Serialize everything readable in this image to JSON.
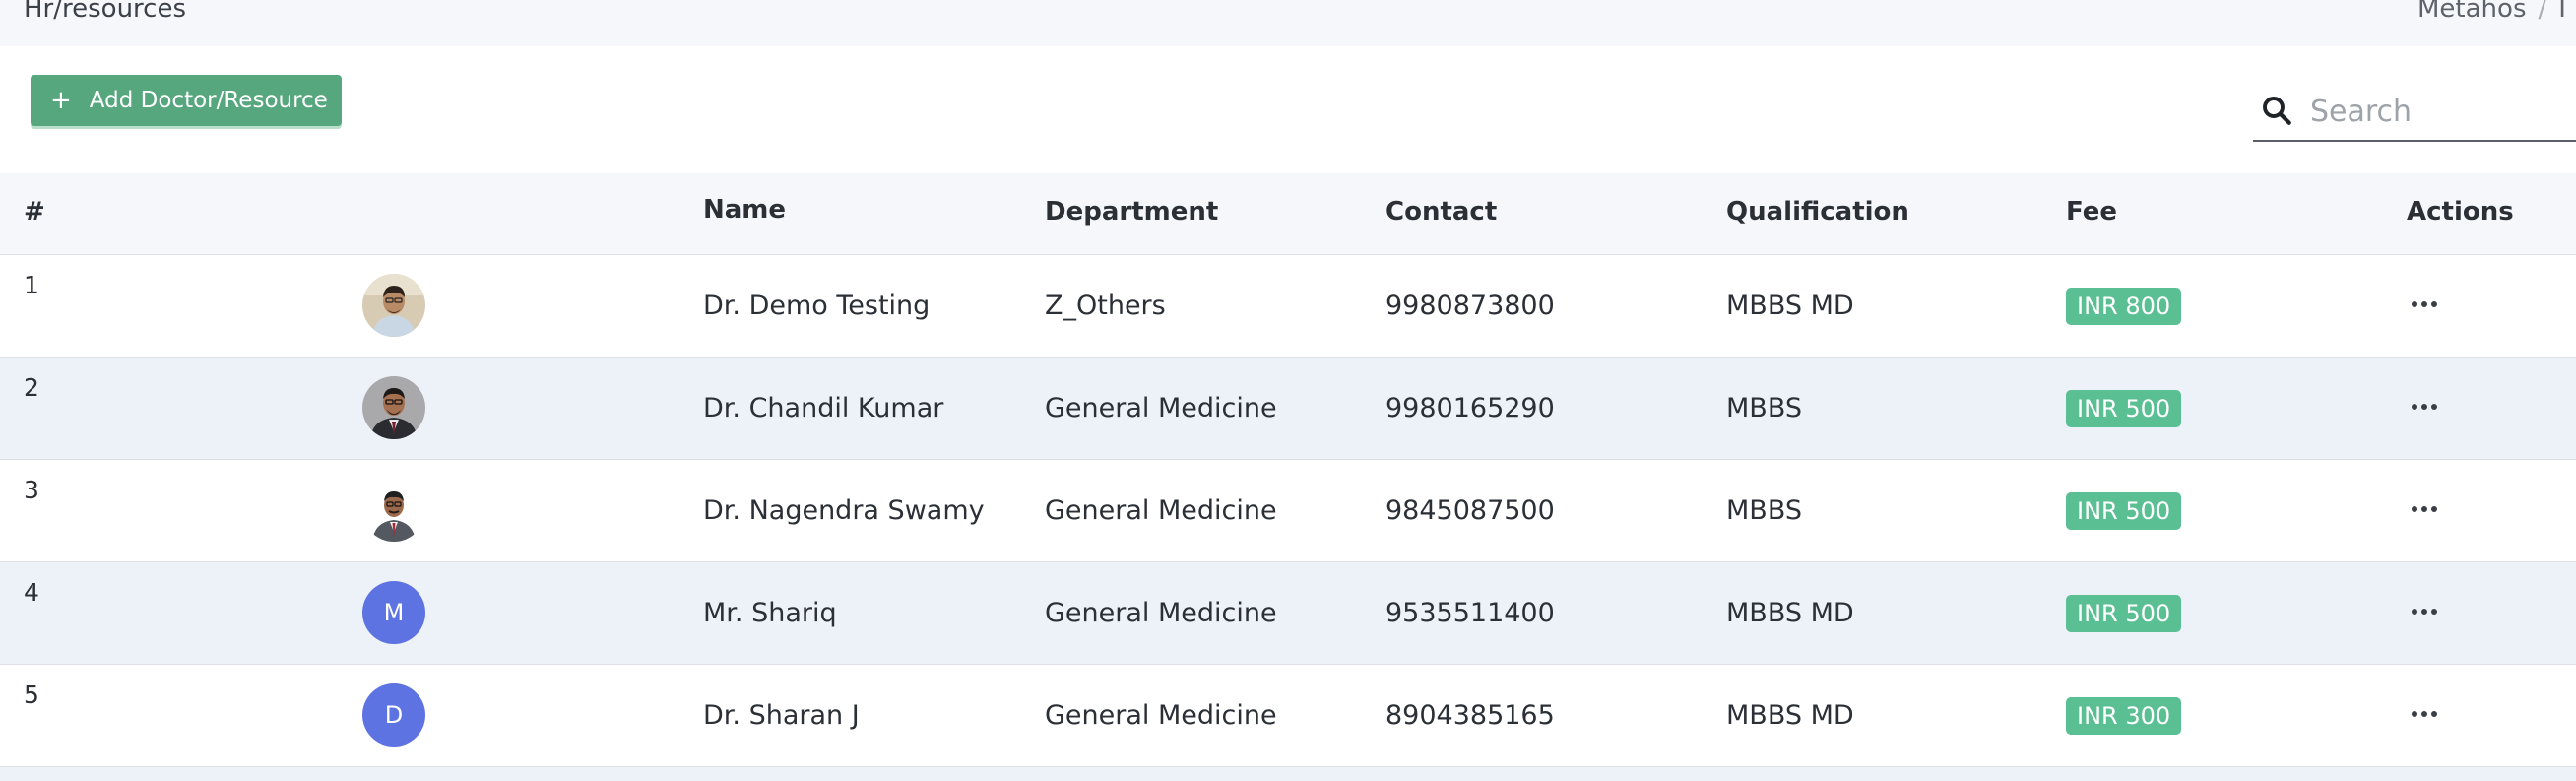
{
  "header": {
    "title": "Hr/resources",
    "breadcrumb": [
      "Metahos",
      "/",
      "I"
    ]
  },
  "toolbar": {
    "add_button_icon": "+",
    "add_button_label": "Add Doctor/Resource",
    "search_placeholder": "Search",
    "search_value": ""
  },
  "table": {
    "columns": [
      "#",
      "",
      "Name",
      "Department",
      "Contact",
      "Qualification",
      "Fee",
      "Actions"
    ],
    "rows": [
      {
        "index": "1",
        "avatar": "photo",
        "avatar_letter": "",
        "name": "Dr. Demo Testing",
        "department": "Z_Others",
        "contact": "9980873800",
        "qualification": "MBBS MD",
        "fee": "INR 800"
      },
      {
        "index": "2",
        "avatar": "photo",
        "avatar_letter": "",
        "name": "Dr. Chandil Kumar",
        "department": "General Medicine",
        "contact": "9980165290",
        "qualification": "MBBS",
        "fee": "INR 500"
      },
      {
        "index": "3",
        "avatar": "photo",
        "avatar_letter": "",
        "name": "Dr. Nagendra Swamy",
        "department": "General Medicine",
        "contact": "9845087500",
        "qualification": "MBBS",
        "fee": "INR 500"
      },
      {
        "index": "4",
        "avatar": "letter",
        "avatar_letter": "M",
        "name": "Mr. Shariq",
        "department": "General Medicine",
        "contact": "9535511400",
        "qualification": "MBBS MD",
        "fee": "INR 500"
      },
      {
        "index": "5",
        "avatar": "letter",
        "avatar_letter": "D",
        "name": "Dr. Sharan J",
        "department": "General Medicine",
        "contact": "8904385165",
        "qualification": "MBBS MD",
        "fee": "INR 300"
      }
    ]
  },
  "colors": {
    "primary_button": "#56a67e",
    "fee_badge": "#5bbf94",
    "letter_avatar": "#5e73e2",
    "row_alt": "#edf1f8",
    "header_bg": "#f6f7fb"
  },
  "icons": {
    "search": "search-icon",
    "actions": "more-horizontal-icon"
  }
}
